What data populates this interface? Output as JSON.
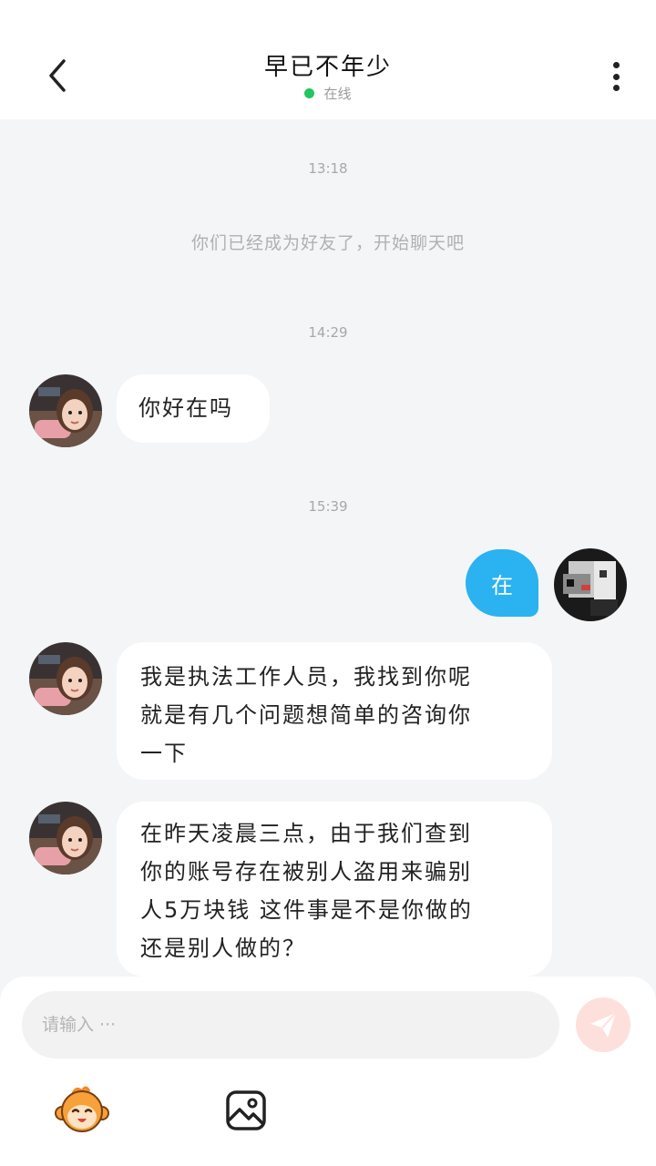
{
  "header": {
    "title": "早已不年少",
    "status": "在线",
    "status_color": "#22c55e",
    "back_icon": "chevron-left-icon",
    "more_icon": "more-vertical-icon"
  },
  "chat": {
    "timestamps": [
      "13:18",
      "14:29",
      "15:39"
    ],
    "system_message": "你们已经成为好友了，开始聊天吧",
    "messages": [
      {
        "from": "contact",
        "lines": [
          "你好在吗"
        ]
      },
      {
        "from": "self",
        "lines": [
          "在"
        ]
      },
      {
        "from": "contact",
        "lines": [
          "我是执法工作人员，我找到你呢",
          "就是有几个问题想简单的咨询你",
          "一下"
        ]
      },
      {
        "from": "contact",
        "lines": [
          "在昨天凌晨三点，由于我们查到",
          "你的账号存在被别人盗用来骗别",
          "人5万块钱 这件事是不是你做的",
          "还是别人做的？"
        ]
      }
    ],
    "outgoing_bubble_color": "#2bb2f0"
  },
  "composer": {
    "placeholder": "请输入 ···",
    "send_icon": "paper-plane-icon",
    "tools": [
      "monkey-emoji-icon",
      "image-icon"
    ]
  }
}
